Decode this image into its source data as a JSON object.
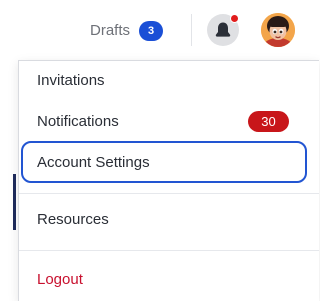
{
  "header": {
    "drafts_label": "Drafts",
    "drafts_count": "3"
  },
  "colors": {
    "drafts_badge": "#1a4fd6",
    "notification_dot": "#e11d1d",
    "notifications_badge": "#c8161a",
    "logout_text": "#c8102e",
    "highlight_outline": "#2255d2"
  },
  "icons": {
    "notifications": "bell-icon",
    "profile": "avatar"
  },
  "menu": {
    "items": [
      {
        "label": "Invitations"
      },
      {
        "label": "Notifications",
        "badge": "30"
      },
      {
        "label": "Account Settings"
      },
      {
        "label": "Resources"
      },
      {
        "label": "Logout"
      }
    ]
  }
}
